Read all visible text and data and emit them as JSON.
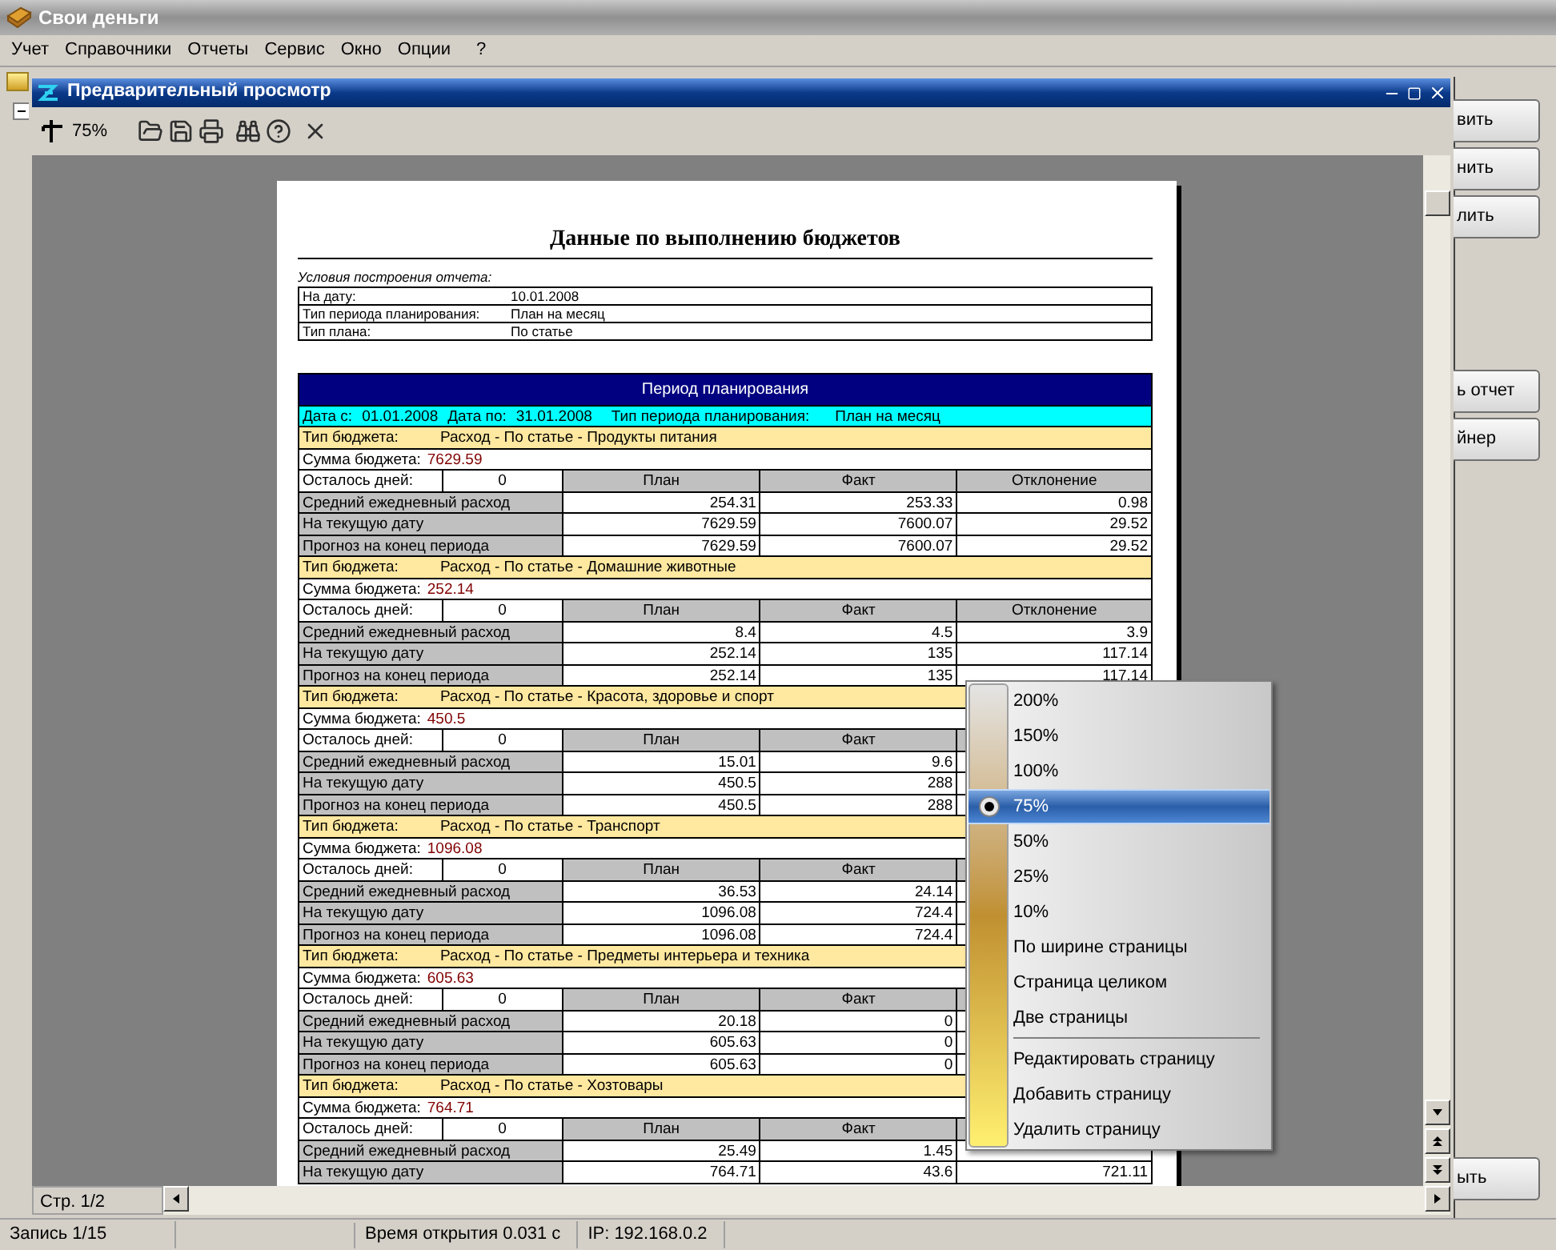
{
  "app": {
    "title": "Свои деньги"
  },
  "menu_bar": [
    "Учет",
    "Справочники",
    "Отчеты",
    "Сервис",
    "Окно",
    "Опции",
    "?"
  ],
  "side_buttons": [
    "вить",
    "нить",
    "лить",
    "ь отчет",
    "йнер",
    "ыть"
  ],
  "preview": {
    "title": "Предварительный просмотр",
    "zoom": "75%",
    "page_indicator": "Стр. 1/2",
    "report": {
      "title": "Данные по выполнению бюджетов",
      "conditions_caption": "Условия построения отчета:",
      "conditions": [
        {
          "label": "На дату:",
          "value": "10.01.2008"
        },
        {
          "label": "Тип периода планирования:",
          "value": "План на месяц"
        },
        {
          "label": "Тип плана:",
          "value": "По статье"
        }
      ],
      "period": {
        "header": "Период планирования",
        "date_from_label": "Дата с:",
        "date_from": "01.01.2008",
        "date_to_label": "Дата по:",
        "date_to": "31.01.2008",
        "period_type_label": "Тип периода планирования:",
        "period_type": "План на месяц"
      },
      "budgets": [
        {
          "type_label": "Тип бюджета:",
          "type": "Расход - По статье - Продукты питания",
          "sum_label": "Сумма бюджета:",
          "sum": "7629.59",
          "days_label": "Осталось дней:",
          "days": "0",
          "headers": [
            "План",
            "Факт",
            "Отклонение"
          ],
          "rows": [
            {
              "label": "Средний ежедневный расход",
              "values": [
                "254.31",
                "253.33",
                "0.98"
              ]
            },
            {
              "label": "На текущую дату",
              "values": [
                "7629.59",
                "7600.07",
                "29.52"
              ]
            },
            {
              "label": "Прогноз на конец периода",
              "values": [
                "7629.59",
                "7600.07",
                "29.52"
              ]
            }
          ]
        },
        {
          "type_label": "Тип бюджета:",
          "type": "Расход - По статье - Домашние животные",
          "sum_label": "Сумма бюджета:",
          "sum": "252.14",
          "days_label": "Осталось дней:",
          "days": "0",
          "headers": [
            "План",
            "Факт",
            "Отклонение"
          ],
          "rows": [
            {
              "label": "Средний ежедневный расход",
              "values": [
                "8.4",
                "4.5",
                "3.9"
              ]
            },
            {
              "label": "На текущую дату",
              "values": [
                "252.14",
                "135",
                "117.14"
              ]
            },
            {
              "label": "Прогноз на конец периода",
              "values": [
                "252.14",
                "135",
                "117.14"
              ]
            }
          ]
        },
        {
          "type_label": "Тип бюджета:",
          "type": "Расход - По статье - Красота, здоровье и спорт",
          "sum_label": "Сумма бюджета:",
          "sum": "450.5",
          "days_label": "Осталось дней:",
          "days": "0",
          "headers": [
            "План",
            "Факт"
          ],
          "rows": [
            {
              "label": "Средний ежедневный расход",
              "values": [
                "15.01",
                "9.6"
              ]
            },
            {
              "label": "На текущую дату",
              "values": [
                "450.5",
                "288"
              ]
            },
            {
              "label": "Прогноз на конец периода",
              "values": [
                "450.5",
                "288"
              ]
            }
          ]
        },
        {
          "type_label": "Тип бюджета:",
          "type": "Расход - По статье - Транспорт",
          "sum_label": "Сумма бюджета:",
          "sum": "1096.08",
          "days_label": "Осталось дней:",
          "days": "0",
          "headers": [
            "План",
            "Факт"
          ],
          "rows": [
            {
              "label": "Средний ежедневный расход",
              "values": [
                "36.53",
                "24.14"
              ]
            },
            {
              "label": "На текущую дату",
              "values": [
                "1096.08",
                "724.4"
              ]
            },
            {
              "label": "Прогноз на конец периода",
              "values": [
                "1096.08",
                "724.4"
              ]
            }
          ]
        },
        {
          "type_label": "Тип бюджета:",
          "type": "Расход - По статье - Предметы интерьера и техника",
          "sum_label": "Сумма бюджета:",
          "sum": "605.63",
          "days_label": "Осталось дней:",
          "days": "0",
          "headers": [
            "План",
            "Факт"
          ],
          "rows": [
            {
              "label": "Средний ежедневный расход",
              "values": [
                "20.18",
                "0"
              ]
            },
            {
              "label": "На текущую дату",
              "values": [
                "605.63",
                "0"
              ]
            },
            {
              "label": "Прогноз на конец периода",
              "values": [
                "605.63",
                "0"
              ]
            }
          ]
        },
        {
          "type_label": "Тип бюджета:",
          "type": "Расход - По статье - Хозтовары",
          "sum_label": "Сумма бюджета:",
          "sum": "764.71",
          "days_label": "Осталось дней:",
          "days": "0",
          "headers": [
            "План",
            "Факт"
          ],
          "rows": [
            {
              "label": "Средний ежедневный расход",
              "values": [
                "25.49",
                "1.45"
              ]
            },
            {
              "label": "На текущую дату",
              "values": [
                "764.71",
                "43.6",
                "721.11"
              ]
            }
          ]
        }
      ]
    }
  },
  "zoom_menu": {
    "options": [
      {
        "label": "200%",
        "selected": false
      },
      {
        "label": "150%",
        "selected": false
      },
      {
        "label": "100%",
        "selected": false
      },
      {
        "label": "75%",
        "selected": true
      },
      {
        "label": "50%",
        "selected": false
      },
      {
        "label": "25%",
        "selected": false
      },
      {
        "label": "10%",
        "selected": false
      },
      {
        "label": "По ширине страницы",
        "selected": false
      },
      {
        "label": "Страница целиком",
        "selected": false
      },
      {
        "label": "Две страницы",
        "selected": false
      }
    ],
    "actions": [
      "Редактировать страницу",
      "Добавить страницу",
      "Удалить страницу"
    ]
  },
  "status_bar": [
    "Запись 1/15",
    "Время открытия 0.031 с",
    "IP: 192.168.0.2"
  ]
}
